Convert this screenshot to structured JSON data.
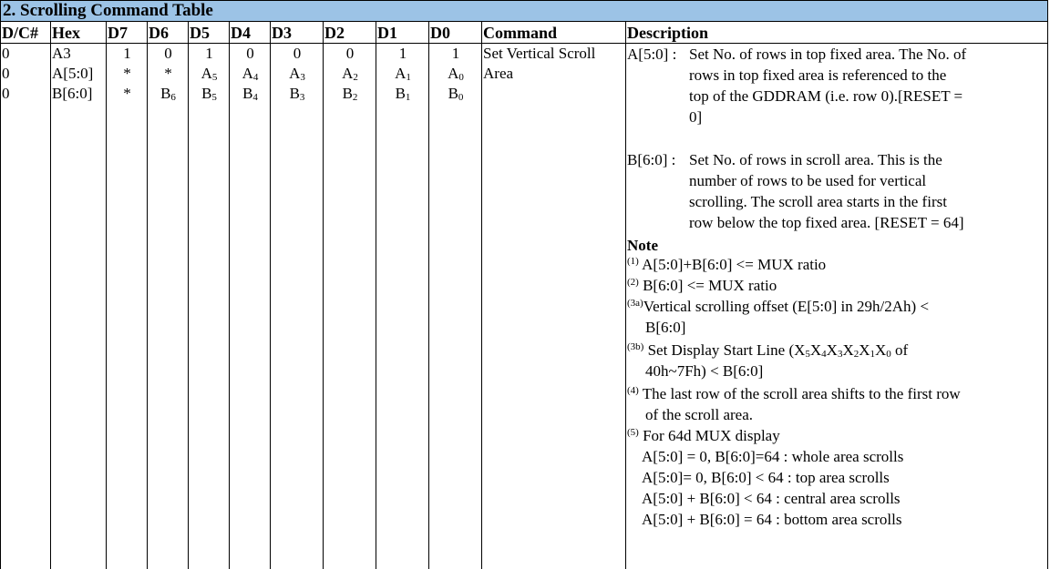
{
  "title": "2. Scrolling Command Table",
  "headers": {
    "dc": "D/C#",
    "hex": "Hex",
    "d7": "D7",
    "d6": "D6",
    "d5": "D5",
    "d4": "D4",
    "d3": "D3",
    "d2": "D2",
    "d1": "D1",
    "d0": "D0",
    "command": "Command",
    "description": "Description"
  },
  "rows": [
    {
      "dc": "0",
      "hex": "A3",
      "d7": "1",
      "d6": "0",
      "d5": "1",
      "d4": "0",
      "d3": "0",
      "d2": "0",
      "d1": "1",
      "d0": "1"
    },
    {
      "dc": "0",
      "hex": "A[5:0]",
      "d7": "*",
      "d6": "*",
      "d5": {
        "b": "A",
        "s": "5"
      },
      "d4": {
        "b": "A",
        "s": "4"
      },
      "d3": {
        "b": "A",
        "s": "3"
      },
      "d2": {
        "b": "A",
        "s": "2"
      },
      "d1": {
        "b": "A",
        "s": "1"
      },
      "d0": {
        "b": "A",
        "s": "0"
      }
    },
    {
      "dc": "0",
      "hex": "B[6:0]",
      "d7": "*",
      "d6": {
        "b": "B",
        "s": "6"
      },
      "d5": {
        "b": "B",
        "s": "5"
      },
      "d4": {
        "b": "B",
        "s": "4"
      },
      "d3": {
        "b": "B",
        "s": "3"
      },
      "d2": {
        "b": "B",
        "s": "2"
      },
      "d1": {
        "b": "B",
        "s": "1"
      },
      "d0": {
        "b": "B",
        "s": "0"
      }
    }
  ],
  "command": {
    "line1": "Set Vertical Scroll",
    "line2": "Area"
  },
  "description": {
    "a_label": "A[5:0] :",
    "a_lines": [
      "Set No. of rows in top fixed area. The No. of",
      "rows in top fixed area is referenced to the",
      "top of the GDDRAM (i.e. row 0).[RESET =",
      "0]"
    ],
    "b_label": "B[6:0] :",
    "b_lines": [
      "Set No. of rows in scroll area. This is the",
      "number of rows to be used for vertical",
      "scrolling. The scroll area starts in the first",
      "row below the top fixed area. [RESET = 64]"
    ],
    "note_title": "Note",
    "notes": [
      {
        "mark": "(1)",
        "text": "A[5:0]+B[6:0] <= MUX ratio"
      },
      {
        "mark": "(2)",
        "text": "B[6:0] <= MUX ratio"
      },
      {
        "mark": "(3a)",
        "text": "Vertical scrolling offset (E[5:0] in 29h/2Ah) <",
        "cont": "B[6:0]"
      },
      {
        "mark": "(3b)",
        "text_pre": "Set Display Start Line (",
        "xs": [
          "5",
          "4",
          "3",
          "2",
          "1",
          "0"
        ],
        "xbase": "X",
        "text_post": " of",
        "cont": "40h~7Fh) < B[6:0]"
      },
      {
        "mark": "(4)",
        "text": "The last row of the scroll area shifts to the first row",
        "cont": "of the scroll area."
      },
      {
        "mark": "(5)",
        "text": "For 64d MUX  display"
      }
    ],
    "mux_lines": [
      "A[5:0] = 0, B[6:0]=64 : whole area scrolls",
      "A[5:0]= 0, B[6:0] < 64 : top area scrolls",
      "A[5:0]  + B[6:0] < 64 : central area scrolls",
      "A[5:0]  + B[6:0] = 64 : bottom area scrolls"
    ]
  }
}
